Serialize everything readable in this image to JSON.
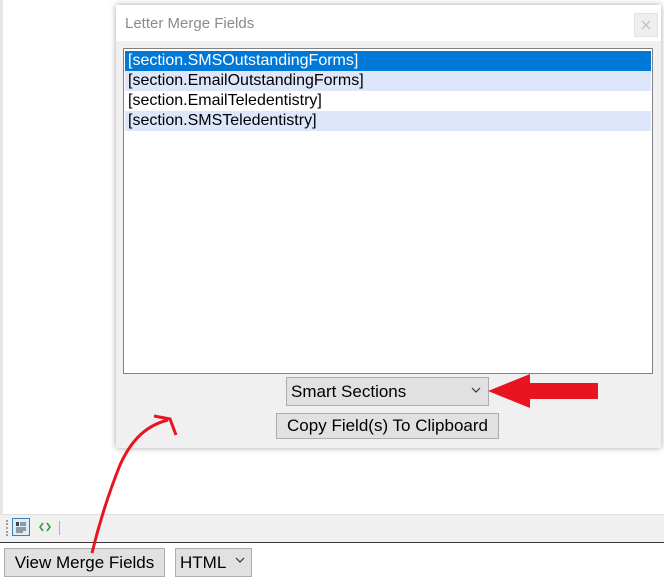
{
  "dialog": {
    "title": "Letter Merge Fields",
    "close_icon": "close-icon",
    "fields": [
      "[section.SMSOutstandingForms]",
      "[section.EmailOutstandingForms]",
      "[section.EmailTeledentistry]",
      "[section.SMSTeledentistry]"
    ],
    "selected_index": 0,
    "section_select": {
      "selected": "Smart Sections"
    },
    "copy_button": "Copy Field(s) To Clipboard"
  },
  "editor_toolbar": {
    "design_icon": "design-view-icon",
    "source_icon": "source-code-icon"
  },
  "bottom_bar": {
    "view_button": "View Merge Fields",
    "format_select": {
      "selected": "HTML"
    }
  },
  "colors": {
    "selection": "#0078d7",
    "alt_row": "#dde6fb",
    "annotation": "#e8141f"
  }
}
